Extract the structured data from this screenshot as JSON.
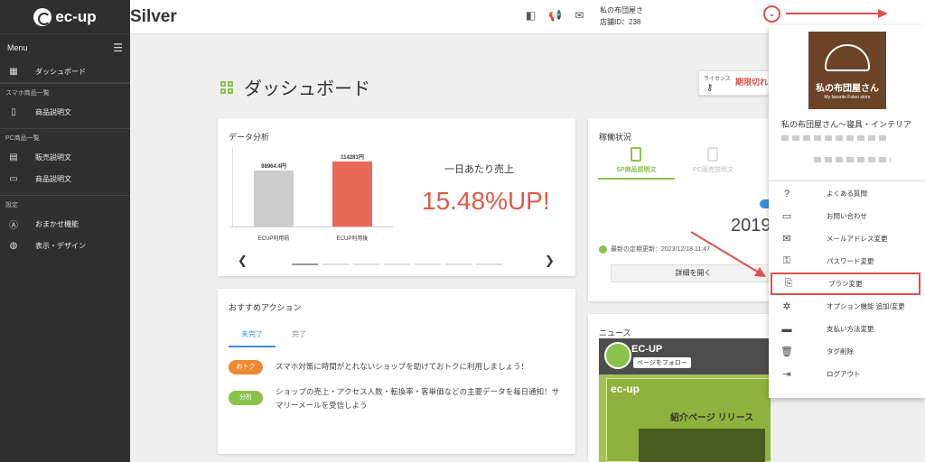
{
  "sidebar": {
    "logo": "ec-up",
    "menu_label": "Menu",
    "dashboard": "ダッシュボード",
    "section_sp": "スマホ商品一覧",
    "sp_desc": "商品説明文",
    "section_pc": "PC商品一覧",
    "pc_sales": "販売説明文",
    "pc_desc": "商品説明文",
    "section_settings": "設定",
    "auto": "おまかせ機能",
    "display": "表示・デザイン"
  },
  "topbar": {
    "plan": "Silver",
    "store_line1": "私の布団屋さ",
    "store_line2": "店舗ID：238"
  },
  "page": {
    "title": "ダッシュボード"
  },
  "license": {
    "label": "ライセンス",
    "status": "期限切れ"
  },
  "analysis": {
    "title": "データ分析",
    "daily_label": "一日あたり売上",
    "increase": "15.48%UP!"
  },
  "chart_data": {
    "type": "bar",
    "categories": [
      "ECUP利用前",
      "ECUP利用後"
    ],
    "values": [
      98964.4,
      114281
    ],
    "value_labels": [
      "98964.4円",
      "114281円"
    ],
    "colors": [
      "#cccccc",
      "#e8695a"
    ]
  },
  "status": {
    "title": "稼働状況",
    "tab_sp": "SP商品説明文",
    "tab_pc": "PC販売説明文",
    "year": "2019",
    "updated": "最新の定期更新：2023/12/18 11:47",
    "detail_button": "詳細を開く"
  },
  "actions": {
    "title": "おすすめアクション",
    "tab_incomplete": "未完了",
    "tab_complete": "完了",
    "items": [
      {
        "tag": "おトク",
        "color": "#ec8a33",
        "text": "スマホ対策に時間がとれないショップを助けておトクに利用しましょう！"
      },
      {
        "tag": "分析",
        "color": "#8bc34a",
        "text": "ショップの売上・アクセス人数・転換率・客単価などの主要データを毎日通知！サマリーメールを受信しよう"
      }
    ]
  },
  "news": {
    "title": "ニュース",
    "page_name": "EC-UP",
    "follow": "ページをフォロー",
    "inner_logo": "ec-up",
    "headline": "紹介ページ リリース"
  },
  "dropdown": {
    "shop_logo_jp": "私の布団屋さん",
    "shop_logo_en": "My favorite Futon store",
    "store_name": "私の布団屋さん〜寝具・インテリア",
    "items": [
      {
        "label": "よくある質問",
        "icon": "?"
      },
      {
        "label": "お問い合わせ",
        "icon": "▭"
      },
      {
        "label": "メールアドレス変更",
        "icon": "✉"
      },
      {
        "label": "パスワード変更",
        "icon": "⚿"
      },
      {
        "label": "プラン変更",
        "icon": "⎘"
      },
      {
        "label": "オプション機能 追加/変更",
        "icon": "✲"
      },
      {
        "label": "支払い方法変更",
        "icon": "▬"
      },
      {
        "label": "タグ削除",
        "icon": "🗑"
      },
      {
        "label": "ログアウト",
        "icon": "⇥"
      }
    ]
  }
}
